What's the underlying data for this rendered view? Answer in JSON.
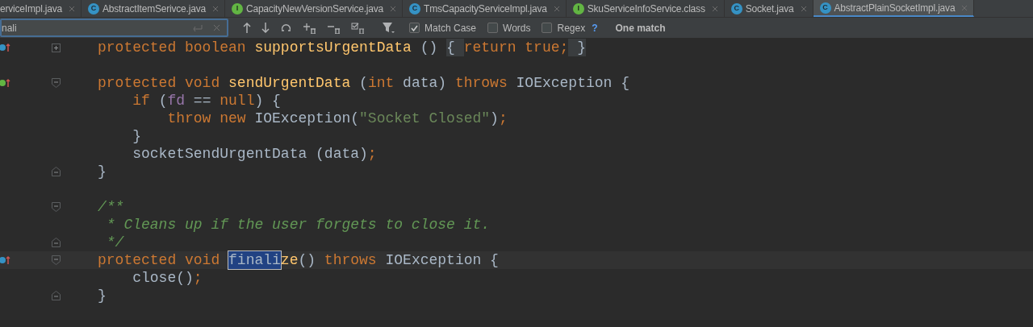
{
  "tabs": [
    {
      "label": "erviceImpl.java",
      "kind": "none",
      "selected": false
    },
    {
      "label": "AbstractItemSerivce.java",
      "kind": "class",
      "icon": "C",
      "selected": false
    },
    {
      "label": "CapacityNewVersionService.java",
      "kind": "interface",
      "icon": "I",
      "selected": false
    },
    {
      "label": "TmsCapacityServiceImpl.java",
      "kind": "class",
      "icon": "C",
      "selected": false
    },
    {
      "label": "SkuServiceInfoService.class",
      "kind": "interface",
      "icon": "I",
      "selected": false
    },
    {
      "label": "Socket.java",
      "kind": "class",
      "icon": "C",
      "selected": false
    },
    {
      "label": "AbstractPlainSocketImpl.java",
      "kind": "class",
      "icon": "C",
      "selected": true
    }
  ],
  "search": {
    "value": "nali",
    "options": [
      {
        "label": "Match Case",
        "checked": true
      },
      {
        "label": "Words",
        "checked": false
      },
      {
        "label": "Regex",
        "checked": false
      }
    ],
    "help": "?",
    "result": "One match"
  },
  "code": [
    {
      "kind": "code",
      "override_marker": true,
      "fold_collapsed": true,
      "tokens": [
        {
          "kind": "keyword",
          "text": "protected boolean "
        },
        {
          "kind": "method",
          "text": "supportsUrgentData"
        },
        {
          "kind": "plain",
          "text": " () "
        },
        {
          "kind": "folded",
          "text": "{ "
        },
        {
          "kind": "keyword",
          "text": "return true;"
        },
        {
          "kind": "folded",
          "text": " }"
        }
      ]
    },
    {
      "kind": "blank"
    },
    {
      "kind": "code",
      "implements_marker": true,
      "fold_start": true,
      "tokens": [
        {
          "kind": "keyword",
          "text": "protected void "
        },
        {
          "kind": "method",
          "text": "sendUrgentData"
        },
        {
          "kind": "plain",
          "text": " ("
        },
        {
          "kind": "keyword",
          "text": "int "
        },
        {
          "kind": "plain",
          "text": "data) "
        },
        {
          "kind": "keyword",
          "text": "throws "
        },
        {
          "kind": "plain",
          "text": "IOException {"
        }
      ]
    },
    {
      "kind": "code",
      "tokens": [
        {
          "kind": "keyword",
          "text": "    if "
        },
        {
          "kind": "plain",
          "text": "("
        },
        {
          "kind": "field",
          "text": "fd"
        },
        {
          "kind": "plain",
          "text": " == "
        },
        {
          "kind": "keyword",
          "text": "null"
        },
        {
          "kind": "plain",
          "text": ") {"
        }
      ]
    },
    {
      "kind": "code",
      "tokens": [
        {
          "kind": "keyword",
          "text": "        throw new "
        },
        {
          "kind": "plain",
          "text": "IOException("
        },
        {
          "kind": "string",
          "text": "\"Socket Closed\""
        },
        {
          "kind": "plain",
          "text": ")"
        },
        {
          "kind": "keyword",
          "text": ";"
        }
      ]
    },
    {
      "kind": "code",
      "tokens": [
        {
          "kind": "plain",
          "text": "    }"
        }
      ]
    },
    {
      "kind": "code",
      "tokens": [
        {
          "kind": "plain",
          "text": "    socketSendUrgentData (data)"
        },
        {
          "kind": "keyword",
          "text": ";"
        }
      ]
    },
    {
      "kind": "code",
      "fold_end": true,
      "tokens": [
        {
          "kind": "plain",
          "text": "}"
        }
      ]
    },
    {
      "kind": "blank"
    },
    {
      "kind": "code",
      "fold_start": true,
      "tokens": [
        {
          "kind": "comment",
          "text": "/**"
        }
      ]
    },
    {
      "kind": "code",
      "tokens": [
        {
          "kind": "comment",
          "text": " * Cleans up if the user forgets to close it."
        }
      ]
    },
    {
      "kind": "code",
      "fold_end": true,
      "tokens": [
        {
          "kind": "comment",
          "text": " */"
        }
      ]
    },
    {
      "kind": "code",
      "override_marker": true,
      "fold_start": true,
      "current": true,
      "tokens": [
        {
          "kind": "keyword",
          "text": "protected void "
        },
        {
          "kind": "match",
          "text": "finali"
        },
        {
          "kind": "method",
          "text": "ze"
        },
        {
          "kind": "plain",
          "text": "() "
        },
        {
          "kind": "keyword",
          "text": "throws "
        },
        {
          "kind": "plain",
          "text": "IOException {"
        }
      ]
    },
    {
      "kind": "code",
      "tokens": [
        {
          "kind": "plain",
          "text": "    close()"
        },
        {
          "kind": "keyword",
          "text": ";"
        }
      ]
    },
    {
      "kind": "code",
      "fold_end": true,
      "tokens": [
        {
          "kind": "plain",
          "text": "}"
        }
      ]
    }
  ]
}
